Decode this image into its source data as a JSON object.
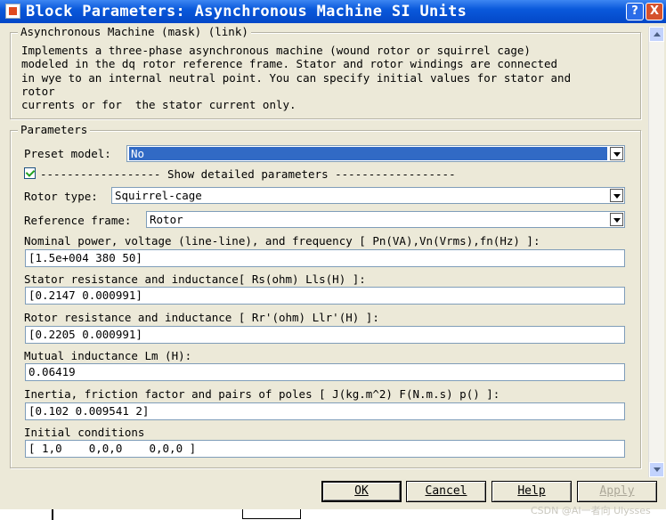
{
  "window": {
    "title": "Block Parameters: Asynchronous Machine SI Units",
    "help_button": "?",
    "close_button": "X"
  },
  "description": {
    "legend": "Asynchronous Machine (mask) (link)",
    "text": "Implements a three-phase asynchronous machine (wound rotor or squirrel cage)\nmodeled in the dq rotor reference frame. Stator and rotor windings are connected\nin wye to an internal neutral point. You can specify initial values for stator and\nrotor\ncurrents or for  the stator current only."
  },
  "parameters": {
    "legend": "Parameters",
    "preset_model": {
      "label": "Preset model:",
      "value": "No"
    },
    "show_detailed": {
      "checked": true,
      "label": "------------------  Show detailed parameters ------------------"
    },
    "rotor_type": {
      "label": "Rotor type:",
      "value": "Squirrel-cage"
    },
    "reference_frame": {
      "label": "Reference frame:",
      "value": "Rotor"
    },
    "nominal": {
      "label": "Nominal power, voltage (line-line), and frequency [ Pn(VA),Vn(Vrms),fn(Hz) ]:",
      "value": "[1.5e+004 380 50]"
    },
    "stator": {
      "label": "Stator resistance and inductance[ Rs(ohm)  Lls(H) ]:",
      "value": "[0.2147 0.000991]"
    },
    "rotor": {
      "label": "Rotor resistance and inductance [ Rr'(ohm)  Llr'(H) ]:",
      "value": "[0.2205 0.000991]"
    },
    "mutual": {
      "label": "Mutual inductance Lm (H):",
      "value": "0.06419"
    },
    "inertia": {
      "label": "Inertia, friction factor and pairs of poles [ J(kg.m^2)  F(N.m.s)  p() ]:",
      "value": "[0.102 0.009541 2]"
    },
    "initial": {
      "label": "Initial conditions",
      "value": "[ 1,0    0,0,0    0,0,0 ]"
    }
  },
  "buttons": {
    "ok": "OK",
    "cancel": "Cancel",
    "help": "Help",
    "apply": "Apply"
  },
  "watermark": "CSDN @AI一者向 Ulysses"
}
